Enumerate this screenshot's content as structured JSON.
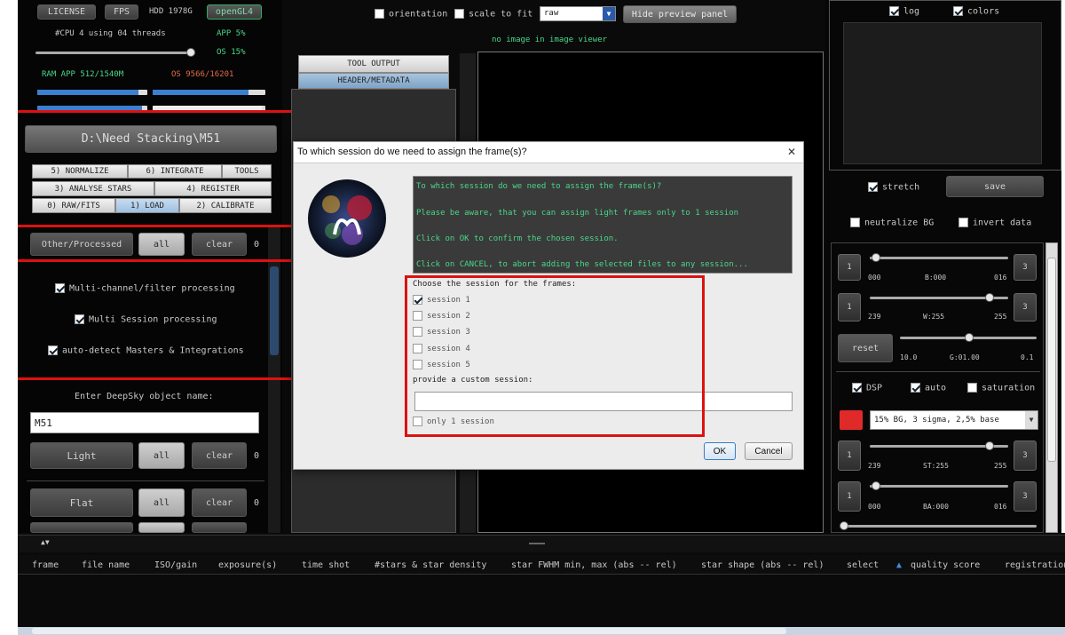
{
  "top": {
    "license": "LICENSE",
    "fps": "FPS",
    "hdd": "HDD 1978G",
    "opengl": "openGL4",
    "cpu": "#CPU 4  using 04 threads",
    "app_pct": "APP 5%",
    "os_pct": "OS 15%",
    "ram": "RAM  APP 512/1540M",
    "os_ram": "OS 9566/16201",
    "cpu_slider": 0.9,
    "ram_bars": [
      0.85,
      0.95,
      0.9,
      0.97
    ]
  },
  "path_button": "D:\\Need Stacking\\M51",
  "tabs": {
    "row1": [
      "5) NORMALIZE",
      "6) INTEGRATE",
      "TOOLS"
    ],
    "row2": [
      "3) ANALYSE STARS",
      "4) REGISTER"
    ],
    "row3": [
      "0) RAW/FITS",
      "1) LOAD",
      "2) CALIBRATE"
    ]
  },
  "other": {
    "label": "Other/Processed",
    "all": "all",
    "clear": "clear",
    "count": "0"
  },
  "options": {
    "multi_channel": "Multi-channel/filter processing",
    "multi_session": "Multi Session processing",
    "auto_detect": "auto-detect Masters & Integrations"
  },
  "object": {
    "label": "Enter DeepSky object name:",
    "value": "M51"
  },
  "light": {
    "label": "Light",
    "all": "all",
    "clear": "clear",
    "count": "0"
  },
  "flat": {
    "label": "Flat",
    "all": "all",
    "clear": "clear",
    "count": "0"
  },
  "toolbar": {
    "orientation": "orientation",
    "scale_to_fit": "scale to fit",
    "raw_select": "raw",
    "hide_preview": "Hide preview panel",
    "no_image": "no image in image viewer"
  },
  "center_tabs": {
    "tool_output": "TOOL OUTPUT",
    "header": "HEADER/METADATA"
  },
  "right": {
    "log": "log",
    "colors": "colors",
    "stretch": "stretch",
    "save": "save",
    "neutralize_bg": "neutralize BG",
    "invert_data": "invert data",
    "s1": {
      "left": "000",
      "mid": "B:000",
      "right": "016",
      "btnL": "1",
      "btnR": "3"
    },
    "s2": {
      "left": "239",
      "mid": "W:255",
      "right": "255",
      "btnL": "1",
      "btnR": "3"
    },
    "reset": "reset",
    "s3": {
      "left": "10.0",
      "mid": "G:01.00",
      "right": "0.1"
    },
    "dsp": "DSP",
    "auto": "auto",
    "saturation": "saturation",
    "preset": "15% BG, 3 sigma, 2,5% base",
    "s4": {
      "left": "239",
      "mid": "ST:255",
      "right": "255",
      "btnL": "1",
      "btnR": "3"
    },
    "s5": {
      "left": "000",
      "mid": "BA:000",
      "right": "016",
      "btnL": "1",
      "btnR": "3"
    }
  },
  "dialog": {
    "title": "To which session do we need to assign the frame(s)?",
    "close": "✕",
    "msg1": "To which session do we need to assign the frame(s)?",
    "msg2": "Please be aware, that you can assign light frames only to 1 session",
    "msg3": "Click on OK to confirm the chosen session.",
    "msg4": "Click on CANCEL, to abort adding the selected files to any session...",
    "choose": "Choose the session for the frames:",
    "sessions": [
      "session 1",
      "session 2",
      "session 3",
      "session 4",
      "session 5"
    ],
    "custom": "provide a custom session:",
    "only1": "only 1 session",
    "ok": "OK",
    "cancel": "Cancel"
  },
  "table": {
    "columns": [
      "frame",
      "file name",
      "ISO/gain",
      "exposure(s)",
      "time shot",
      "#stars & star density",
      "star FWHM min, max (abs -- rel)",
      "star shape (abs -- rel)",
      "select",
      "quality score",
      "registration"
    ]
  }
}
